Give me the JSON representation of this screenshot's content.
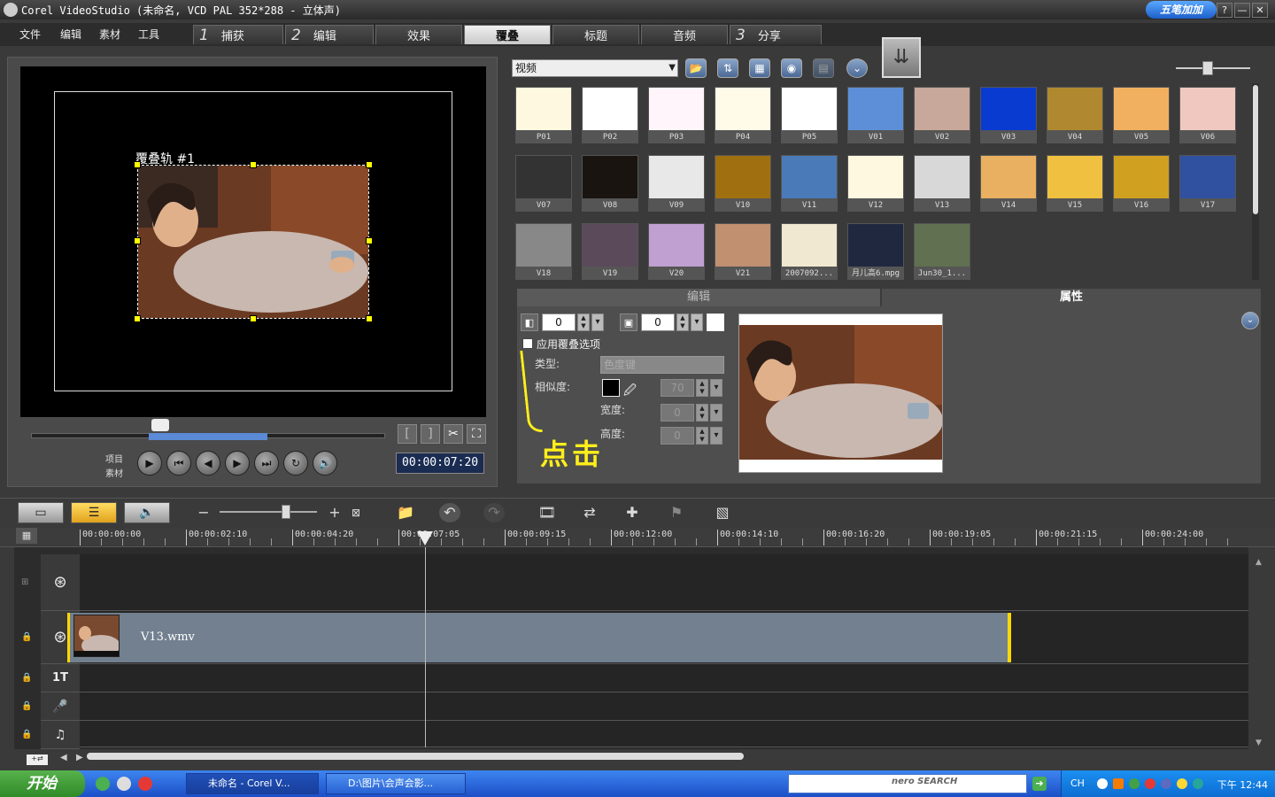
{
  "window": {
    "title": "Corel VideoStudio (未命名, VCD PAL 352*288 - 立体声)",
    "promo_label": "五笔加加",
    "help_label": "?",
    "minimize_label": "—",
    "close_label": "✕"
  },
  "menu": {
    "file": "文件",
    "edit": "编辑",
    "clip": "素材",
    "tools": "工具"
  },
  "steps": [
    {
      "num": "1",
      "label": "捕获"
    },
    {
      "num": "2",
      "label": "编辑"
    },
    {
      "num": "",
      "label": "效果"
    },
    {
      "num": "",
      "label": "覆叠",
      "active": true
    },
    {
      "num": "",
      "label": "标题"
    },
    {
      "num": "",
      "label": "音频"
    },
    {
      "num": "3",
      "label": "分享"
    }
  ],
  "preview": {
    "overlay_label": "覆叠轨 #1",
    "project_label": "项目",
    "clip_label": "素材",
    "timecode": "00:00:07:20"
  },
  "library": {
    "category": "视频",
    "thumbnails": [
      {
        "caption": "P01",
        "color": "#fff8e0"
      },
      {
        "caption": "P02",
        "color": "#ffffff"
      },
      {
        "caption": "P03",
        "color": "#fff5fb"
      },
      {
        "caption": "P04",
        "color": "#fffbe8"
      },
      {
        "caption": "P05",
        "color": "#ffffff"
      },
      {
        "caption": "V01",
        "color": "#5d8fd8"
      },
      {
        "caption": "V02",
        "color": "#c8a89a"
      },
      {
        "caption": "V03",
        "color": "#0a3bd0"
      },
      {
        "caption": "V04",
        "color": "#b08830"
      },
      {
        "caption": "V05",
        "color": "#f0b060"
      },
      {
        "caption": "V06",
        "color": "#f0c8c0"
      },
      {
        "caption": "V07",
        "color": "#333333"
      },
      {
        "caption": "V08",
        "color": "#1a1410"
      },
      {
        "caption": "V09",
        "color": "#e8e8e8"
      },
      {
        "caption": "V10",
        "color": "#a07010"
      },
      {
        "caption": "V11",
        "color": "#4a7ab8"
      },
      {
        "caption": "V12",
        "color": "#fff8e0"
      },
      {
        "caption": "V13",
        "color": "#d8d8d8"
      },
      {
        "caption": "V14",
        "color": "#e8b060"
      },
      {
        "caption": "V15",
        "color": "#f0c040"
      },
      {
        "caption": "V16",
        "color": "#d0a020"
      },
      {
        "caption": "V17",
        "color": "#3050a0"
      },
      {
        "caption": "V18",
        "color": "#888888"
      },
      {
        "caption": "V19",
        "color": "#5a4a5a"
      },
      {
        "caption": "V20",
        "color": "#c0a0d0"
      },
      {
        "caption": "V21",
        "color": "#c09070"
      },
      {
        "caption": "2007092...",
        "color": "#f0e8d0"
      },
      {
        "caption": "月儿高6.mpg",
        "color": "#202840"
      },
      {
        "caption": "Jun30_1...",
        "color": "#607050"
      }
    ]
  },
  "options": {
    "tab_edit": "编辑",
    "tab_attributes": "属性",
    "transparency_value": "0",
    "border_value": "0",
    "apply_overlay_label": "应用覆叠选项",
    "type_label": "类型:",
    "type_value": "色度键",
    "similarity_label": "相似度:",
    "similarity_value": "70",
    "width_label": "宽度:",
    "width_value": "0",
    "height_label": "高度:",
    "height_value": "0",
    "annotation": "点击"
  },
  "timeline": {
    "ruler": [
      "00:00:00:00",
      "00:00:02:10",
      "00:00:04:20",
      "00:00:07:05",
      "00:00:09:15",
      "00:00:12:00",
      "00:00:14:10",
      "00:00:16:20",
      "00:00:19:05",
      "00:00:21:15",
      "00:00:24:00"
    ],
    "clip_name": "V13.wmv",
    "title_track_label": "1T"
  },
  "taskbar": {
    "start_label": "开始",
    "tasks": [
      {
        "label": "未命名 - Corel V..."
      },
      {
        "label": "D:\\图片\\会声会影..."
      }
    ],
    "nero_label": "nero SEARCH",
    "ime_label": "CH",
    "clock": "下午 12:44"
  }
}
